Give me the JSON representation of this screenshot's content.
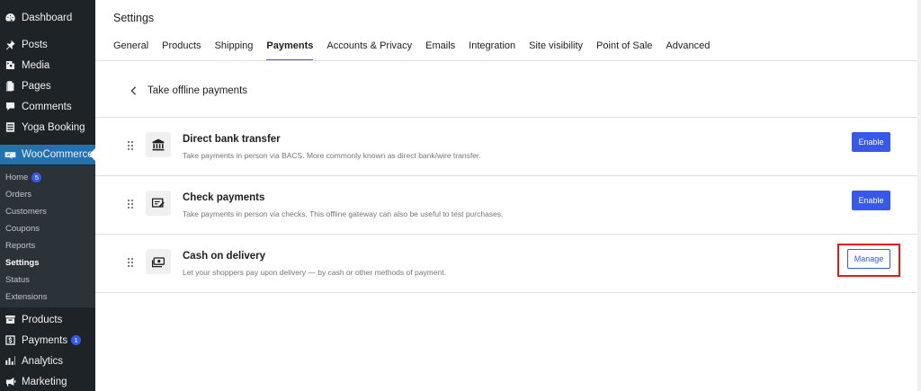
{
  "sidebar": {
    "top_items": [
      {
        "label": "Dashboard",
        "icon": "dashboard-icon"
      },
      {
        "label": "Posts",
        "icon": "pin-icon"
      },
      {
        "label": "Media",
        "icon": "media-icon"
      },
      {
        "label": "Pages",
        "icon": "pages-icon"
      },
      {
        "label": "Comments",
        "icon": "comment-icon"
      },
      {
        "label": "Yoga Booking",
        "icon": "list-icon"
      }
    ],
    "woocommerce": {
      "label": "WooCommerce",
      "icon": "woo-icon"
    },
    "submenu": [
      {
        "label": "Home",
        "badge": "5"
      },
      {
        "label": "Orders"
      },
      {
        "label": "Customers"
      },
      {
        "label": "Coupons"
      },
      {
        "label": "Reports"
      },
      {
        "label": "Settings"
      },
      {
        "label": "Status"
      },
      {
        "label": "Extensions"
      }
    ],
    "bottom_items": [
      {
        "label": "Products",
        "icon": "archive-icon"
      },
      {
        "label": "Payments",
        "icon": "dollar-icon",
        "badge": "1"
      },
      {
        "label": "Analytics",
        "icon": "chart-icon"
      },
      {
        "label": "Marketing",
        "icon": "megaphone-icon"
      }
    ]
  },
  "header": {
    "title": "Settings",
    "tabs": [
      "General",
      "Products",
      "Shipping",
      "Payments",
      "Accounts & Privacy",
      "Emails",
      "Integration",
      "Site visibility",
      "Point of Sale",
      "Advanced"
    ],
    "active_tab": "Payments"
  },
  "section": {
    "back_title": "Take offline payments"
  },
  "gateways": [
    {
      "title": "Direct bank transfer",
      "description": "Take payments in person via BACS. More commonly known as direct bank/wire transfer.",
      "button": "Enable",
      "icon": "bank-icon"
    },
    {
      "title": "Check payments",
      "description": "Take payments in person via checks. This offline gateway can also be useful to test purchases.",
      "button": "Enable",
      "icon": "check-icon"
    },
    {
      "title": "Cash on delivery",
      "description": "Let your shoppers pay upon delivery — by cash or other methods of payment.",
      "button": "Manage",
      "icon": "cash-icon"
    }
  ],
  "colors": {
    "accent": "#3858e9",
    "sidebar": "#1d2327",
    "highlight": "#e21a1a",
    "active_menu": "#2271b1"
  }
}
